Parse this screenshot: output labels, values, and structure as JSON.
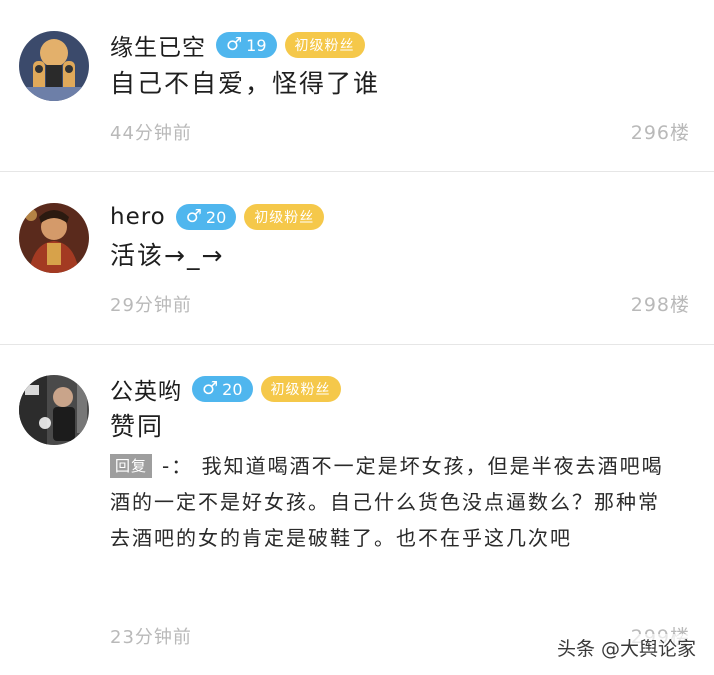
{
  "comments": [
    {
      "username": "缘生已空",
      "gender_icon": "male-symbol",
      "age": "19",
      "level": "初级粉丝",
      "content": "自己不自爱，怪得了谁",
      "time": "44分钟前",
      "floor": "296楼"
    },
    {
      "username": "hero",
      "gender_icon": "male-symbol",
      "age": "20",
      "level": "初级粉丝",
      "content": "活该→_→",
      "time": "29分钟前",
      "floor": "298楼"
    },
    {
      "username": "公英哟",
      "gender_icon": "male-symbol",
      "age": "20",
      "level": "初级粉丝",
      "content": "赞同",
      "reply_label": "回复",
      "reply_text": "-：  我知道喝酒不一定是坏女孩，但是半夜去酒吧喝酒的一定不是好女孩。自己什么货色没点逼数么？那种常去酒吧的女的肯定是破鞋了。也不在乎这几次吧",
      "time": "23分钟前",
      "floor": "299楼"
    }
  ],
  "watermark": "头条 @大舆论家",
  "colors": {
    "gender_badge": "#4fb6ee",
    "fan_badge": "#f5c84a",
    "meta_text": "#b9b9b9",
    "divider": "#e6e6e6"
  }
}
